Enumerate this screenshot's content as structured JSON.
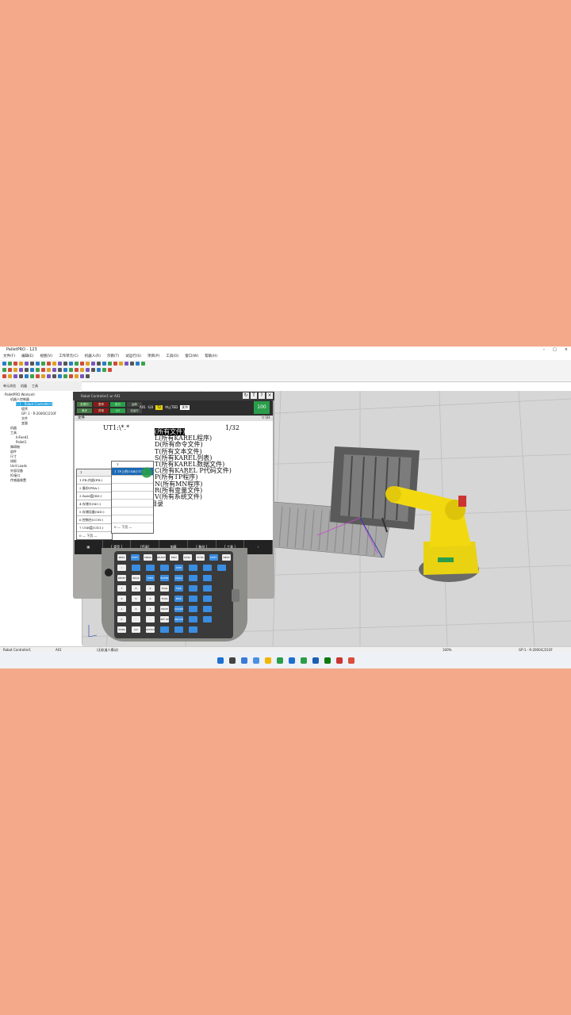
{
  "window": {
    "title": "PalletPRO - 123",
    "controls": [
      "–",
      "□",
      "×"
    ]
  },
  "menu": [
    "文件(F)",
    "编辑(E)",
    "视图(V)",
    "工作单元(C)",
    "机器人(R)",
    "示教(T)",
    "试运行(S)",
    "项目(P)",
    "工具(O)",
    "窗口(W)",
    "帮助(H)"
  ],
  "tree": {
    "tabs": [
      "单元浏览",
      "机器",
      "工具"
    ],
    "items": [
      {
        "label": "PalletPRO Workcell",
        "indent": 0,
        "selected": false
      },
      {
        "label": "机器人控制器",
        "indent": 1,
        "selected": false
      },
      {
        "label": "C:1 - Robot Controller1",
        "indent": 2,
        "selected": true
      },
      {
        "label": "程序",
        "indent": 3,
        "selected": false
      },
      {
        "label": "GP: 1 - R-2000iC/210F",
        "indent": 3,
        "selected": false
      },
      {
        "label": "文件",
        "indent": 3,
        "selected": false
      },
      {
        "label": "变量",
        "indent": 3,
        "selected": false
      },
      {
        "label": "机器",
        "indent": 1,
        "selected": false
      },
      {
        "label": "工具",
        "indent": 1,
        "selected": false
      },
      {
        "label": "InFeed1",
        "indent": 2,
        "selected": false
      },
      {
        "label": "Pallet1",
        "indent": 2,
        "selected": false
      },
      {
        "label": "障碍物",
        "indent": 1,
        "selected": false
      },
      {
        "label": "部件",
        "indent": 1,
        "selected": false
      },
      {
        "label": "尺寸",
        "indent": 1,
        "selected": false
      },
      {
        "label": "线框",
        "indent": 1,
        "selected": false
      },
      {
        "label": "Unit Loads",
        "indent": 1,
        "selected": false
      },
      {
        "label": "外部设备",
        "indent": 1,
        "selected": false
      },
      {
        "label": "IO接口",
        "indent": 1,
        "selected": false
      },
      {
        "label": "传感器装置",
        "indent": 1,
        "selected": false
      }
    ],
    "bottom_tabs": [
      "BIBIDDIDE",
      "单元浏览"
    ]
  },
  "pendant": {
    "title": "Robot Controller1 w: All1",
    "lamps": [
      "处理中",
      "单步",
      "暂停",
      "异常",
      "执行",
      "I/O",
      "运转",
      "试运行"
    ],
    "status_info": {
      "program": "All1",
      "line": "行0",
      "mode": "T2",
      "state": "中止TED",
      "joint": "关节"
    },
    "override": "100",
    "sub_label": "文件",
    "sub_icons": "▽ [H",
    "path": "UT1:\\*.*",
    "count": "1/32",
    "lines": [
      "(所有文件)",
      "(所有KAREL程序)",
      "(所有命令文件)",
      "(所有文本文件)",
      "(所有KAREL列表)",
      "(所有KAREL数据文件)",
      "(所有KAREL P代码文件)",
      "(所有TP程序)",
      "(所有MN程序)",
      "(所有变量文件)",
      "(所有系统文件)"
    ],
    "line_prefixes": [
      "",
      "L",
      "D",
      "T",
      "S",
      "T",
      "C",
      "P",
      "N",
      "R",
      "V"
    ],
    "bottom_line": "按键，目前目录",
    "popup1": {
      "header": "1",
      "items": [
        "1 FR:内部(FR:)",
        "2 备份(FRA:)",
        "3 RAM盘(RD:)",
        "4 存储卡(MC:)",
        "5 存储设备(MD:)",
        "6 控制台(CON:)",
        "7 USB盘(UD1:)",
        "0 — 下页 —"
      ]
    },
    "popup2": {
      "header": "1",
      "items": [
        "1 TP上的USB(UT1:)",
        "",
        "",
        "",
        "",
        "",
        "",
        "0 — 下页 —"
      ]
    },
    "fkeys": [
      "▦",
      "[ 类型 ]",
      "[目录]",
      "加载",
      "[ 备份 ]",
      "[ 工具 ]",
      "›"
    ]
  },
  "keypad": {
    "rows": [
      [
        "PREV",
        "SHIFT",
        "MENU",
        "SELECT",
        "EDIT",
        "DATA",
        "FCTN",
        "SHIFT",
        "NEXT"
      ],
      [
        "i",
        "",
        "",
        "",
        "STEP",
        "",
        "",
        ""
      ],
      [
        "RESET",
        "BACK SPACE",
        "ITEM",
        "ENTER",
        "HOLD",
        "",
        ""
      ],
      [
        "7",
        "8",
        "9",
        "TOOL 1",
        "FWD",
        "",
        ""
      ],
      [
        "4",
        "5",
        "6",
        "TOOL 2",
        "BWD",
        "",
        ""
      ],
      [
        "1",
        "2",
        "3",
        "MOVE MENU",
        "COORD",
        "",
        ""
      ],
      [
        "0",
        ".",
        "-",
        "SET UP",
        "GROUP",
        "",
        ""
      ],
      [
        "POSN",
        "I/O",
        "STATUS",
        "",
        "",
        ""
      ]
    ]
  },
  "statusbar": {
    "controller": "Robot Controller1",
    "program": "All1",
    "message": "(无轨道人模动)",
    "zoom": "100%",
    "group": "GP:1 - R-2000iC/210F"
  },
  "colors": {
    "background": "#f4a98a",
    "selection": "#1ea0e0",
    "pendant_highlight": "#1b69b5",
    "override_green": "#2a9d4a",
    "robot_yellow": "#f2d90f"
  }
}
